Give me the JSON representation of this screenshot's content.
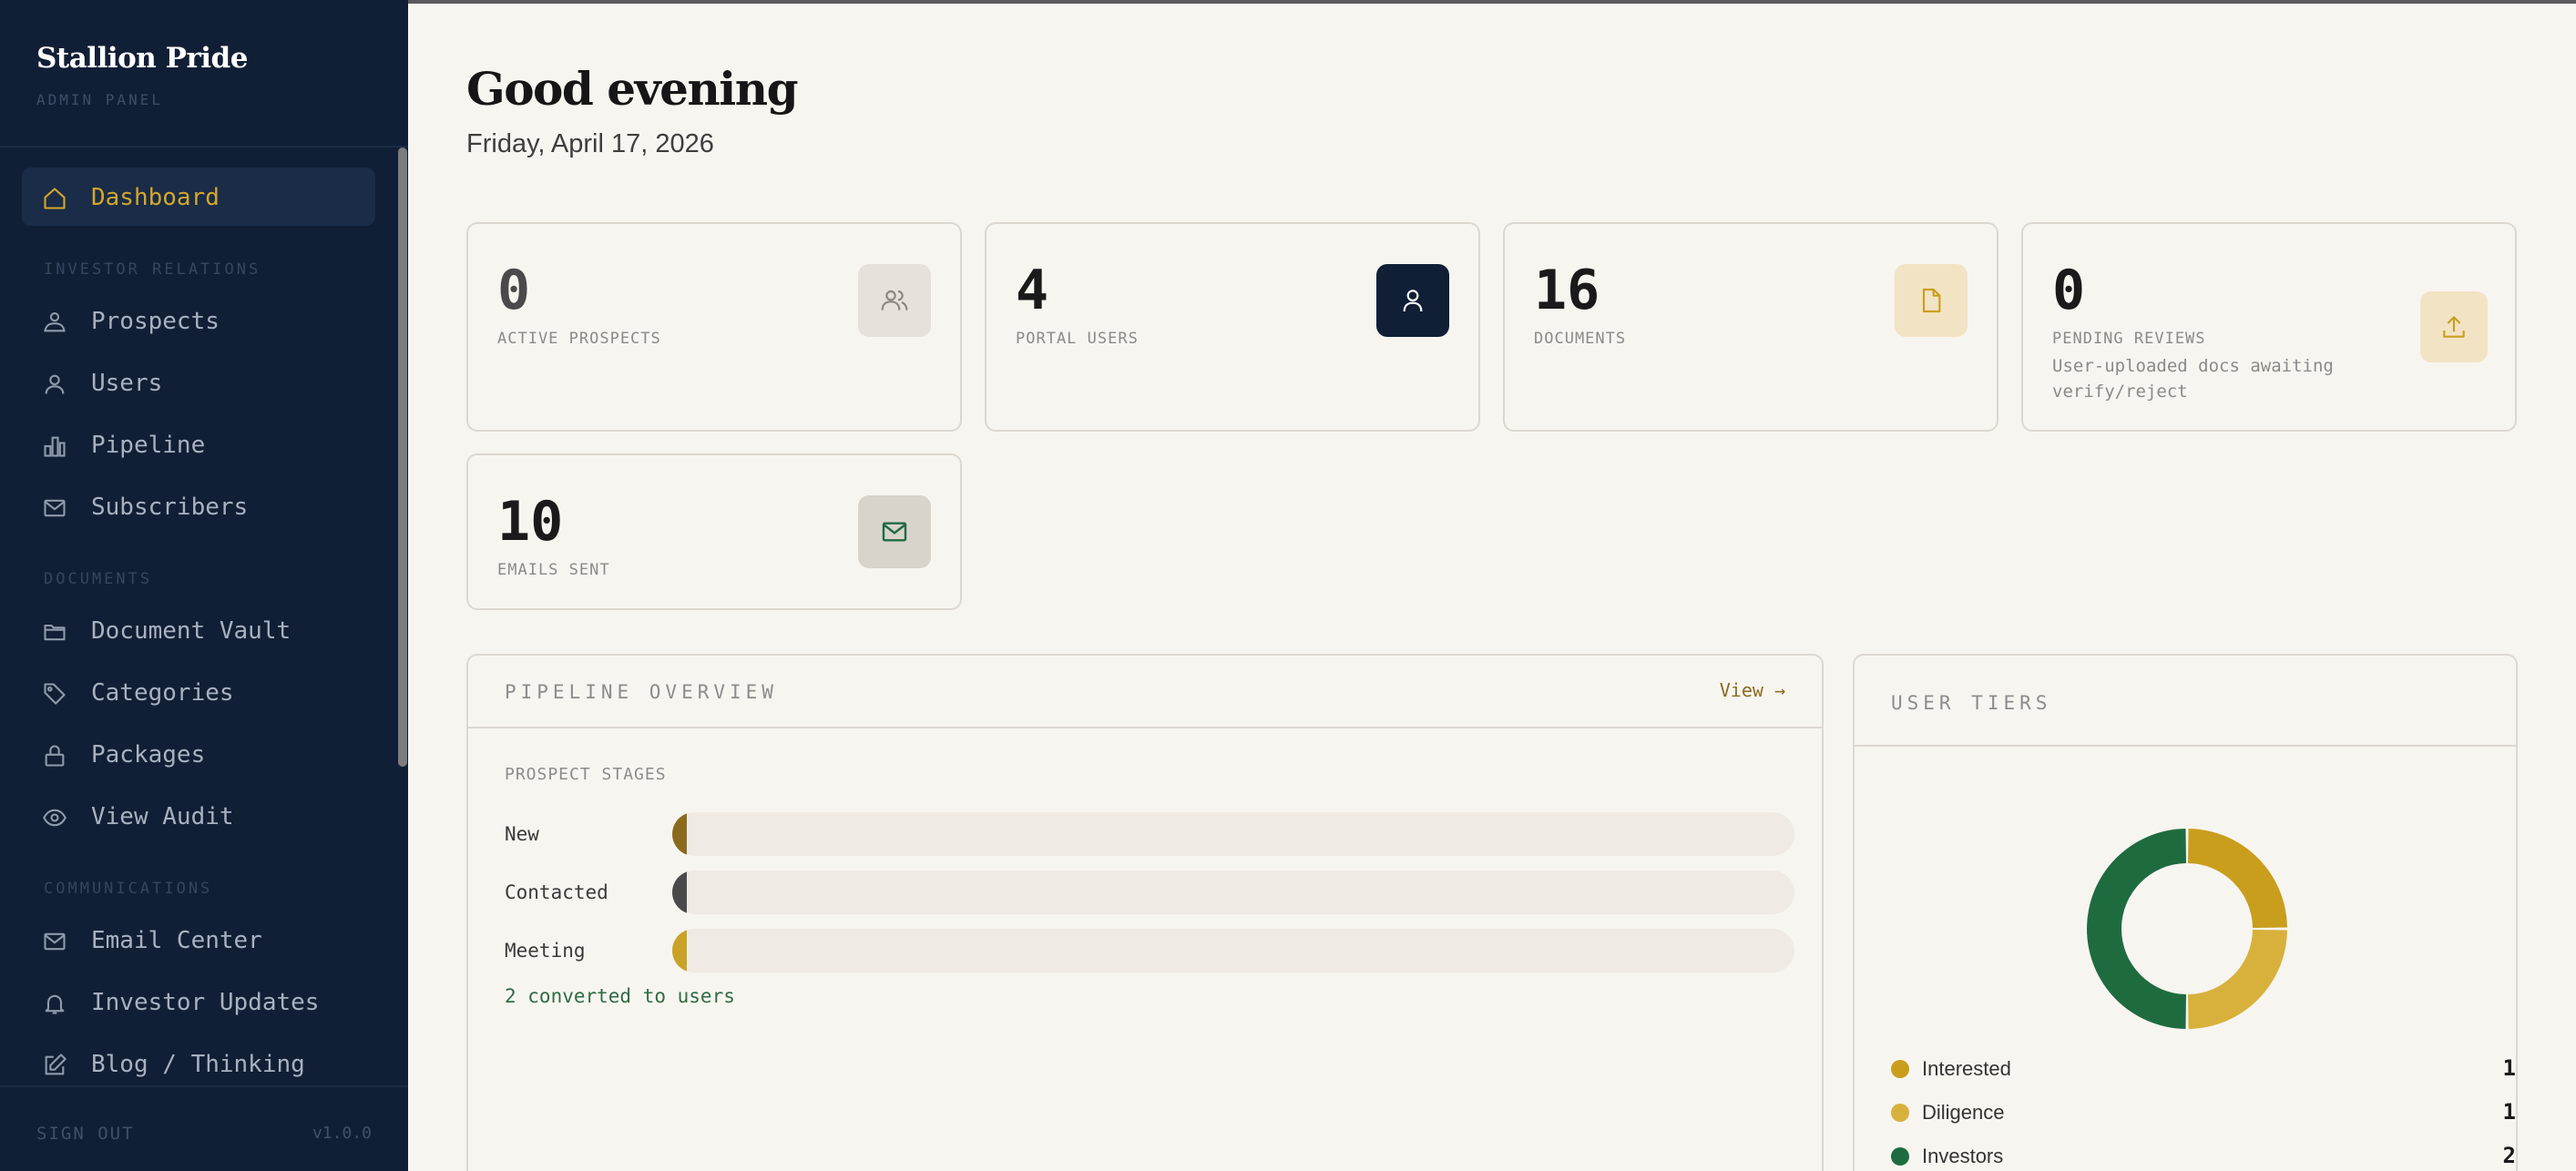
{
  "sidebar": {
    "brand": "Stallion Pride",
    "brand_sub": "ADMIN PANEL",
    "active": "Dashboard",
    "sections": {
      "investor": "INVESTOR RELATIONS",
      "documents": "DOCUMENTS",
      "communications": "COMMUNICATIONS"
    },
    "items": [
      {
        "label": "Dashboard",
        "icon": "home-icon"
      },
      {
        "label": "Prospects",
        "icon": "prospects-icon"
      },
      {
        "label": "Users",
        "icon": "user-icon"
      },
      {
        "label": "Pipeline",
        "icon": "bar-chart-icon"
      },
      {
        "label": "Subscribers",
        "icon": "mail-icon"
      },
      {
        "label": "Document Vault",
        "icon": "folder-icon"
      },
      {
        "label": "Categories",
        "icon": "tag-icon"
      },
      {
        "label": "Packages",
        "icon": "lock-icon"
      },
      {
        "label": "View Audit",
        "icon": "eye-icon"
      },
      {
        "label": "Email Center",
        "icon": "mail-icon"
      },
      {
        "label": "Investor Updates",
        "icon": "bell-icon"
      },
      {
        "label": "Blog / Thinking",
        "icon": "edit-icon"
      }
    ],
    "sign_out": "SIGN OUT",
    "version": "v1.0.0"
  },
  "header": {
    "greeting": "Good evening",
    "date": "Friday, April 17, 2026"
  },
  "stats": [
    {
      "value": "0",
      "label": "ACTIVE PROSPECTS",
      "icon": "users-icon"
    },
    {
      "value": "4",
      "label": "PORTAL USERS",
      "icon": "user-icon"
    },
    {
      "value": "16",
      "label": "DOCUMENTS",
      "icon": "document-icon"
    },
    {
      "value": "0",
      "label": "PENDING REVIEWS",
      "desc": "User-uploaded docs awaiting verify/reject",
      "icon": "upload-icon"
    },
    {
      "value": "10",
      "label": "EMAILS SENT",
      "icon": "mail-icon"
    }
  ],
  "pipeline": {
    "title": "PIPELINE OVERVIEW",
    "view_link": "View →",
    "subtitle": "PROSPECT STAGES",
    "stages": [
      {
        "label": "New",
        "fraction": 0.01,
        "color": "#8a6b1e"
      },
      {
        "label": "Contacted",
        "fraction": 0.01,
        "color": "#4a4a4a"
      },
      {
        "label": "Meeting",
        "fraction": 0.01,
        "color": "#c9a227"
      }
    ],
    "converted": "2 converted to users"
  },
  "tiers": {
    "title": "USER TIERS"
  },
  "chart_data": {
    "type": "pie",
    "categories": [
      "Interested",
      "Diligence",
      "Investors"
    ],
    "values": [
      1,
      1,
      2
    ],
    "colors": [
      "#c99e1c",
      "#d8b13c",
      "#1f6b40"
    ],
    "donut": true
  }
}
